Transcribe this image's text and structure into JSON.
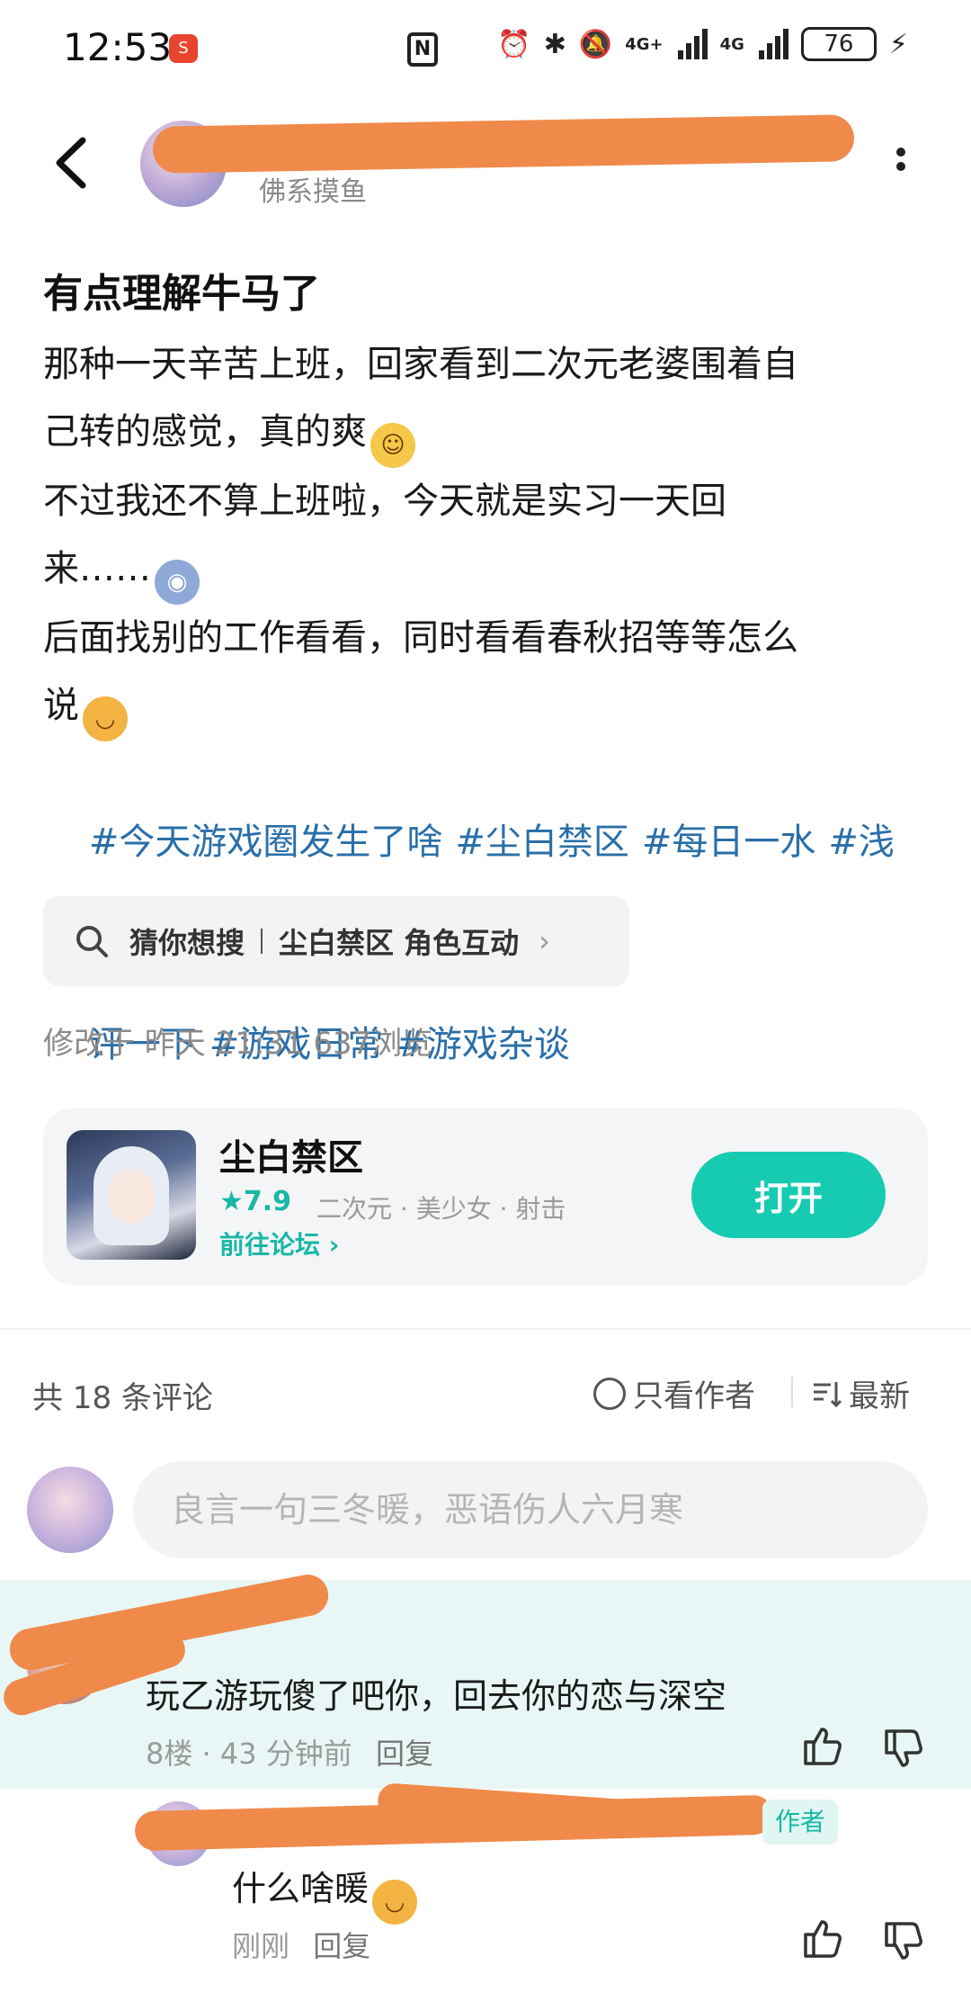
{
  "status_bar": {
    "time": "12:53",
    "app_badge": "S",
    "nfc": "N",
    "net1": "4G+",
    "net2": "4G",
    "battery": "76"
  },
  "header": {
    "author_subtitle": "佛系摸鱼"
  },
  "post": {
    "title": "有点理解牛马了",
    "lines": [
      "那种一天辛苦上班，回家看到二次元老婆围着自",
      "己转的感觉，真的爽",
      "不过我还不算上班啦，今天就是实习一天回",
      "来……",
      "后面找别的工作看看，同时看看春秋招等等怎么",
      "说"
    ],
    "hashtags_line1": [
      "#今天游戏圈发生了啥",
      "#尘白禁区",
      "#每日一水",
      "#浅"
    ],
    "hashtags_line2": [
      "评一下",
      "#游戏日常",
      "#游戏杂谈"
    ],
    "meta": "修改于 昨天 21:31   637浏览"
  },
  "search_suggest": {
    "lead": "猜你想搜",
    "query": "尘白禁区 角色互动"
  },
  "game_card": {
    "title": "尘白禁区",
    "rating": "7.9",
    "tags": "二次元 · 美少女 · 射击",
    "forum_link": "前往论坛",
    "open_label": "打开"
  },
  "comments": {
    "count_label": "共 18 条评论",
    "author_only_label": "只看作者",
    "sort_label": "最新",
    "input_placeholder": "良言一句三冬暖，恶语伤人六月寒",
    "items": [
      {
        "text": "玩乙游玩傻了吧你，回去你的恋与深空",
        "floor": "8楼",
        "time": "43 分钟前",
        "reply_label": "回复"
      }
    ],
    "reply": {
      "badge": "作者",
      "text": "什么啥暖",
      "time": "刚刚",
      "reply_label": "回复"
    }
  },
  "colors": {
    "accent": "#17cbb3",
    "hashtag": "#2a6fa8",
    "redaction": "#f08a4b",
    "highlight_bg": "#e8f7f5"
  },
  "icons": [
    "back-arrow-icon",
    "more-icon",
    "search-icon",
    "star-icon",
    "chevron-right-icon",
    "circle-icon",
    "sort-icon",
    "thumb-up-icon",
    "thumb-down-icon"
  ]
}
